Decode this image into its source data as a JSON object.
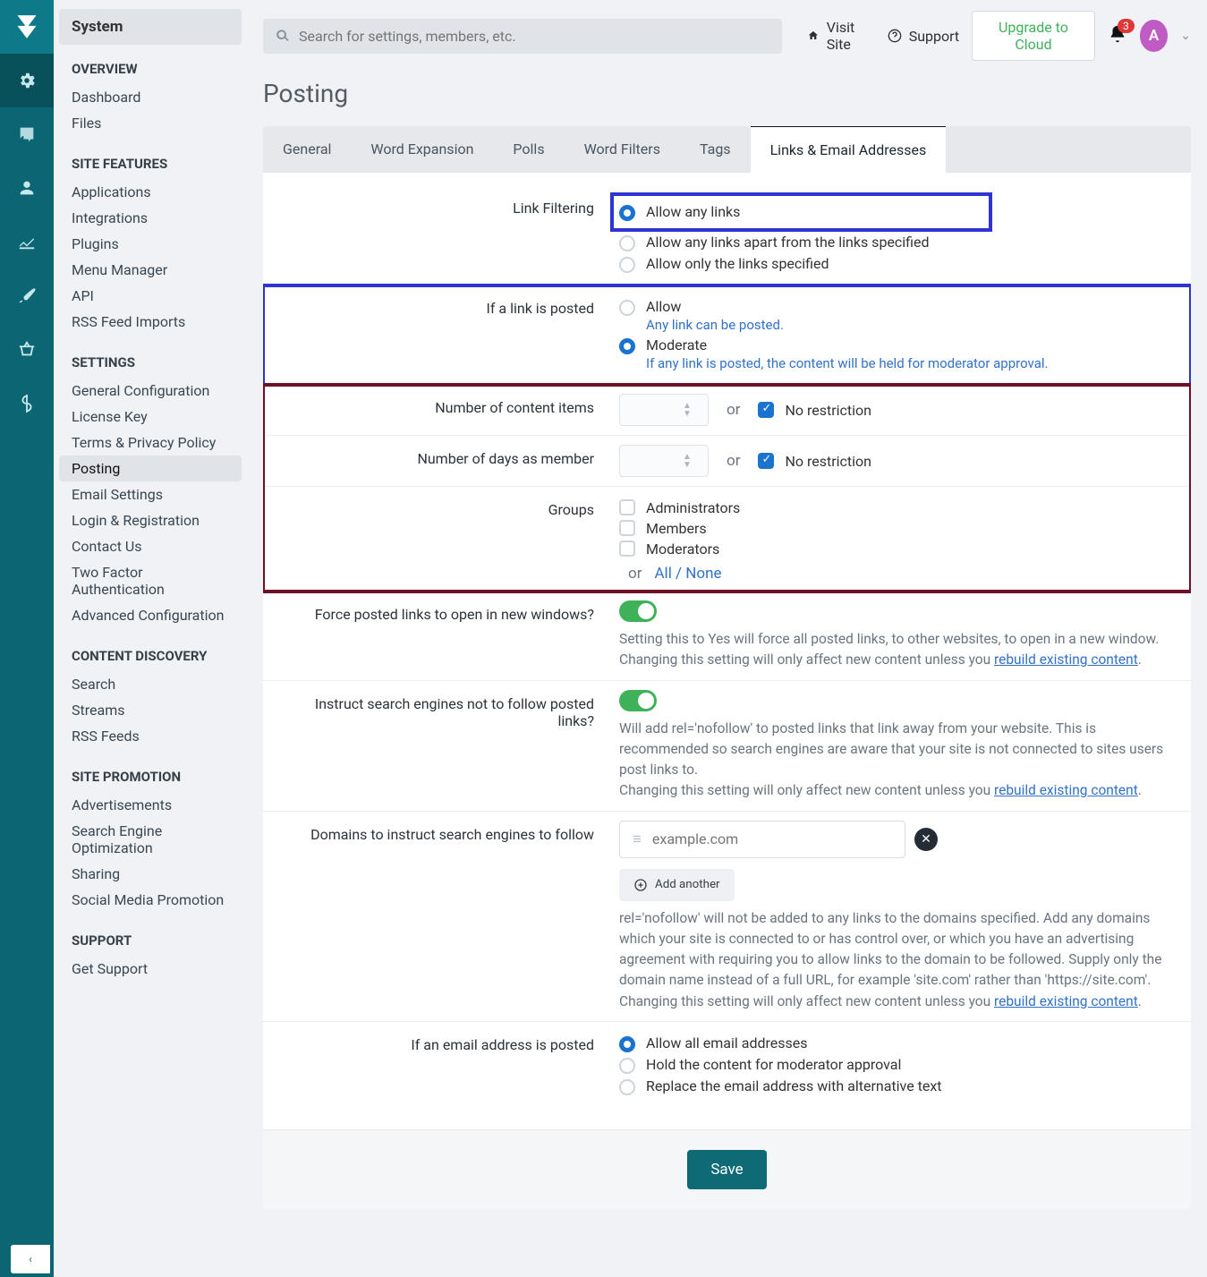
{
  "header": {
    "search_placeholder": "Search for settings, members, etc.",
    "visit_site": "Visit Site",
    "support": "Support",
    "upgrade": "Upgrade to Cloud",
    "notif_count": "3",
    "avatar_initial": "A"
  },
  "sidebar": {
    "title": "System",
    "groups": [
      {
        "heading": "OVERVIEW",
        "items": [
          "Dashboard",
          "Files"
        ]
      },
      {
        "heading": "SITE FEATURES",
        "items": [
          "Applications",
          "Integrations",
          "Plugins",
          "Menu Manager",
          "API",
          "RSS Feed Imports"
        ]
      },
      {
        "heading": "SETTINGS",
        "items": [
          "General Configuration",
          "License Key",
          "Terms & Privacy Policy",
          "Posting",
          "Email Settings",
          "Login & Registration",
          "Contact Us",
          "Two Factor Authentication",
          "Advanced Configuration"
        ],
        "active": "Posting"
      },
      {
        "heading": "CONTENT DISCOVERY",
        "items": [
          "Search",
          "Streams",
          "RSS Feeds"
        ]
      },
      {
        "heading": "SITE PROMOTION",
        "items": [
          "Advertisements",
          "Search Engine Optimization",
          "Sharing",
          "Social Media Promotion"
        ]
      },
      {
        "heading": "SUPPORT",
        "items": [
          "Get Support"
        ]
      }
    ]
  },
  "page": {
    "title": "Posting",
    "tabs": [
      "General",
      "Word Expansion",
      "Polls",
      "Word Filters",
      "Tags",
      "Links & Email Addresses"
    ],
    "active_tab": "Links & Email Addresses"
  },
  "form": {
    "link_filtering": {
      "label": "Link Filtering",
      "options": [
        "Allow any links",
        "Allow any links apart from the links specified",
        "Allow only the links specified"
      ],
      "selected": 0
    },
    "if_link_posted": {
      "label": "If a link is posted",
      "options": [
        {
          "title": "Allow",
          "help": "Any link can be posted."
        },
        {
          "title": "Moderate",
          "help": "If any link is posted, the content will be held for moderator approval."
        }
      ],
      "selected": 1
    },
    "num_content": {
      "label": "Number of content items",
      "or": "or",
      "no_restriction": "No restriction"
    },
    "num_days": {
      "label": "Number of days as member",
      "or": "or",
      "no_restriction": "No restriction"
    },
    "groups": {
      "label": "Groups",
      "options": [
        "Administrators",
        "Members",
        "Moderators"
      ],
      "all_none_or": "or",
      "all_none": "All / None"
    },
    "force_new_window": {
      "label": "Force posted links to open in new windows?",
      "desc1": "Setting this to Yes will force all posted links, to other websites, to open in a new window.",
      "desc2": "Changing this setting will only affect new content unless you ",
      "rebuild": "rebuild existing content",
      "dot": "."
    },
    "nofollow": {
      "label": "Instruct search engines not to follow posted links?",
      "desc1": "Will add rel='nofollow' to posted links that link away from your website. This is recommended so search engines are aware that your site is not connected to sites users post links to.",
      "desc2": "Changing this setting will only affect new content unless you ",
      "rebuild": "rebuild existing content",
      "dot": "."
    },
    "domains": {
      "label": "Domains to instruct search engines to follow",
      "placeholder": "example.com",
      "add": "Add another",
      "desc1": "rel='nofollow' will not be added to any links to the domains specified. Add any domains which your site is connected to or has control over, or which you have an advertising agreement with requiring you to allow links to the domain to be followed. Supply only the domain name instead of a full URL, for example 'site.com' rather than 'https://site.com'.",
      "desc2": "Changing this setting will only affect new content unless you ",
      "rebuild": "rebuild existing content",
      "dot": "."
    },
    "email_posted": {
      "label": "If an email address is posted",
      "options": [
        "Allow all email addresses",
        "Hold the content for moderator approval",
        "Replace the email address with alternative text"
      ],
      "selected": 0
    },
    "save": "Save"
  }
}
